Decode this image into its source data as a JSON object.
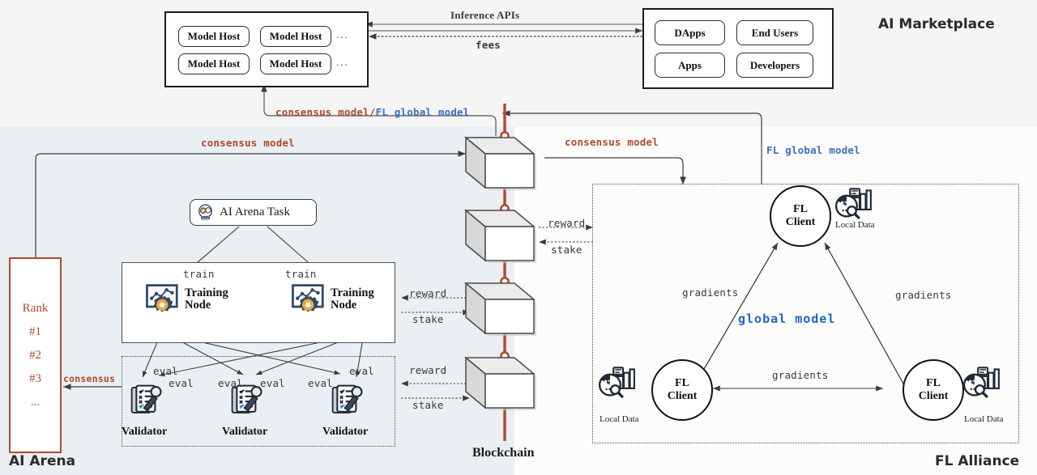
{
  "regions": {
    "marketplace": {
      "title": "AI Marketplace",
      "bg": "#f5f5f5"
    },
    "arena": {
      "title": "AI Arena",
      "bg": "#e9eff3"
    },
    "fl": {
      "title": "FL Alliance",
      "bg": "#fcfcfa"
    },
    "blockchain": {
      "title": "Blockchain"
    }
  },
  "colors": {
    "red": "#b1492c",
    "blue": "#3a6fc4",
    "blue_big": "#1f66c7",
    "dark": "#3a3a3a",
    "chain": "#b44a2a",
    "icon_navy": "#2e4a6b",
    "icon_amber": "#f2a93b"
  },
  "marketplace": {
    "hosts_box": {
      "items": [
        "Model Host",
        "Model Host",
        "Model Host",
        "Model Host"
      ],
      "ellipsis": [
        "...",
        "..."
      ]
    },
    "consumers_box": {
      "items": [
        "DApps",
        "End Users",
        "Apps",
        "Developers"
      ]
    },
    "links": {
      "top": "Inference APIs",
      "bottom": "fees"
    }
  },
  "arena": {
    "rank_panel": {
      "title": "Rank",
      "entries": [
        "#1",
        "#2",
        "#3",
        "..."
      ]
    },
    "task": {
      "label": "AI Arena Task",
      "icon": "robot-head-gear-icon"
    },
    "training_nodes": [
      {
        "label_line1": "Training",
        "label_line2": "Node",
        "icon": "training-chart-gear-icon"
      },
      {
        "label_line1": "Training",
        "label_line2": "Node",
        "icon": "training-chart-gear-icon"
      }
    ],
    "validators": [
      {
        "label": "Validator",
        "icon": "clipboard-checklist-icon"
      },
      {
        "label": "Validator",
        "icon": "clipboard-checklist-icon"
      },
      {
        "label": "Validator",
        "icon": "clipboard-checklist-icon"
      }
    ],
    "edge_labels": {
      "train": [
        "train",
        "train"
      ],
      "eval": [
        "eval",
        "eval",
        "eval",
        "eval",
        "eval",
        "eval"
      ],
      "consensus": "consensus"
    },
    "chain_labels": {
      "training_reward": "reward",
      "training_stake": "stake",
      "validator_reward": "reward",
      "validator_stake": "stake"
    }
  },
  "fl": {
    "clients": [
      {
        "line1": "FL",
        "line2": "Client",
        "data_label": "Local Data",
        "data_icon": "analytics-chart-icon"
      },
      {
        "line1": "FL",
        "line2": "Client",
        "data_label": "Local Data",
        "data_icon": "analytics-chart-icon"
      },
      {
        "line1": "FL",
        "line2": "Client",
        "data_label": "Local Data",
        "data_icon": "analytics-chart-icon"
      }
    ],
    "center_label": "global model",
    "gradients": [
      "gradients",
      "gradients",
      "gradients"
    ],
    "chain_labels": {
      "reward": "reward",
      "stake": "stake"
    }
  },
  "flows": {
    "consensus_model_left": "consensus model",
    "consensus_model_right": "consensus model",
    "fl_global_model": "FL global model",
    "combined_red": "consensus model/",
    "combined_blue": "FL global model"
  },
  "blockchain": {
    "blocks": 4,
    "label": "Blockchain"
  }
}
